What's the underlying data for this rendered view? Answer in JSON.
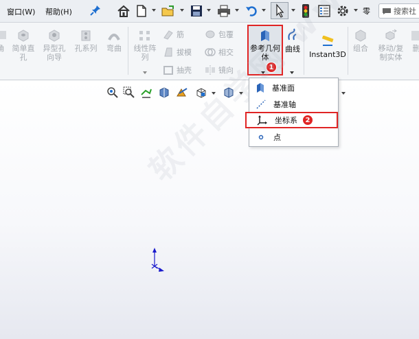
{
  "menu": {
    "window": "窗口(W)",
    "help": "帮助(H)"
  },
  "search": {
    "label": "搜索社"
  },
  "quick_access": {
    "more": "零"
  },
  "ribbon": {
    "left_cut": "角",
    "simple_hole": "简单直孔",
    "hole_wizard": "异型孔向导",
    "hole_series": "孔系列",
    "bend": "弯曲",
    "linear_pattern": "线性阵列",
    "rib": "筋",
    "draft": "拔模",
    "shell": "抽壳",
    "wrap": "包覆",
    "intersect": "相交",
    "mirror": "镜向",
    "ref_geometry": "参考几何体",
    "curves": "曲线",
    "instant3d": "Instant3D",
    "combine": "组合",
    "move_copy": "移动/复制实体",
    "delete": "删"
  },
  "dropdown": {
    "items": [
      "基准面",
      "基准轴",
      "坐标系",
      "点"
    ]
  },
  "badges": {
    "one": "1",
    "two": "2"
  },
  "watermark": "软件自学网 www.rjzxw.com",
  "colors": {
    "highlight": "#e02424",
    "axis": "#1a1acc"
  }
}
